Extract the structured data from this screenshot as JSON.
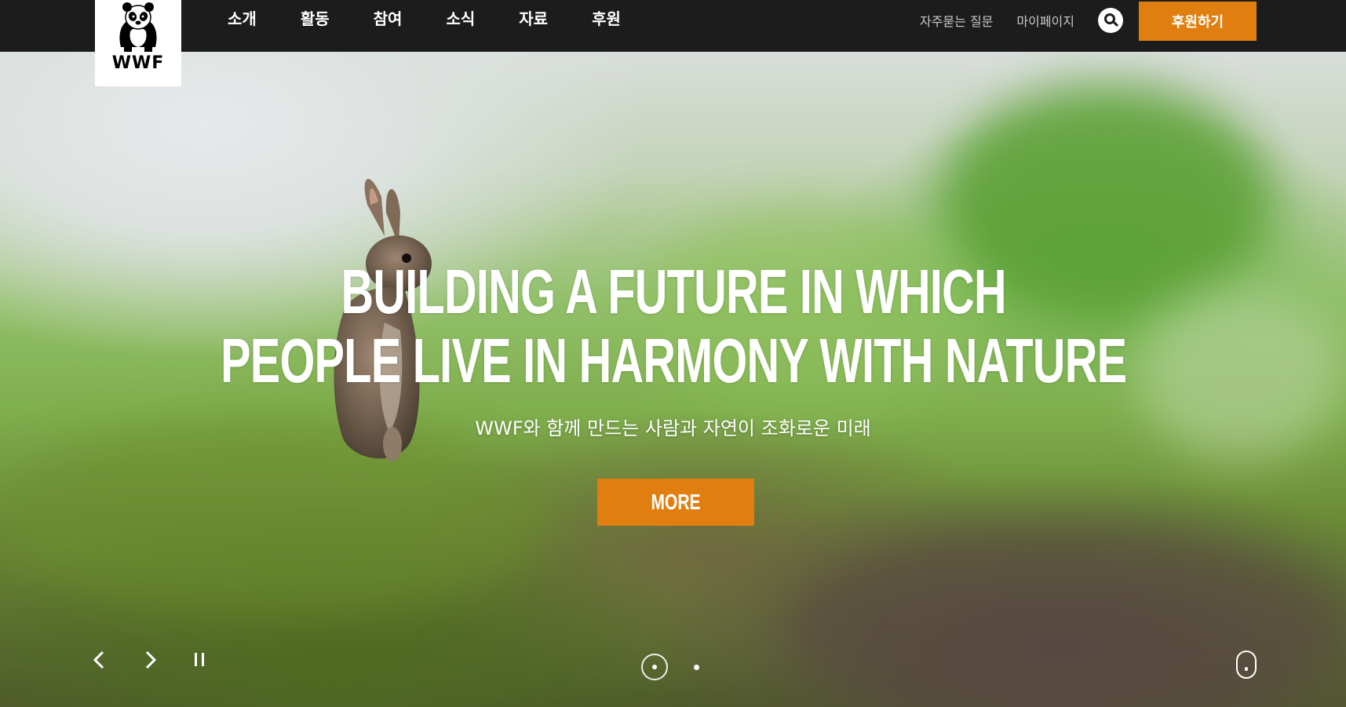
{
  "logo": {
    "text": "WWF",
    "icon": "panda-icon"
  },
  "nav": {
    "items": [
      {
        "label": "소개"
      },
      {
        "label": "활동"
      },
      {
        "label": "참여"
      },
      {
        "label": "소식"
      },
      {
        "label": "자료"
      },
      {
        "label": "후원"
      }
    ]
  },
  "utility": {
    "faq_label": "자주묻는 질문",
    "mypage_label": "마이페이지",
    "search_icon": "search-icon",
    "donate_label": "후원하기"
  },
  "hero": {
    "title_line1": "BUILDING A FUTURE IN WHICH",
    "title_line2": "PEOPLE LIVE IN HARMONY WITH NATURE",
    "subtitle": "WWF와 함께 만드는 사람과 자연이 조화로운 미래",
    "more_label": "MORE",
    "slides_total": 2,
    "active_slide": 1
  },
  "colors": {
    "accent": "#e07f0f",
    "topbar": "#1c1c1c",
    "white": "#ffffff"
  }
}
